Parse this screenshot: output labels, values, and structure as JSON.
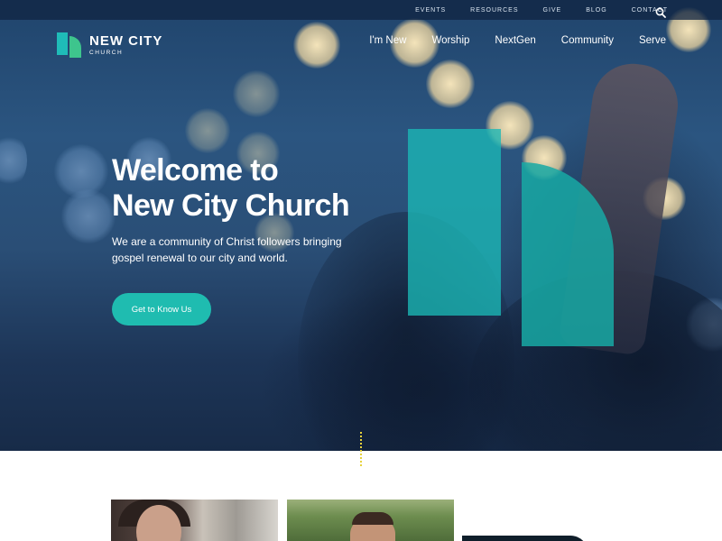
{
  "utility_nav": {
    "items": [
      "EVENTS",
      "RESOURCES",
      "GIVE",
      "BLOG",
      "CONTACT"
    ],
    "search_icon": "search-icon"
  },
  "logo": {
    "name": "NEW CITY",
    "sub": "CHURCH"
  },
  "main_nav": {
    "items": [
      "I'm New",
      "Worship",
      "NextGen",
      "Community",
      "Serve"
    ]
  },
  "hero": {
    "title_line1": "Welcome to",
    "title_line2": "New City Church",
    "subtitle": "We are a community of Christ followers bringing gospel renewal to our city and world.",
    "cta_label": "Get to Know Us"
  },
  "colors": {
    "accent_teal": "#1fbcb0",
    "logo_green": "#3ec58d",
    "hero_blue": "#2b5580",
    "scroll_line": "#e7d23c"
  }
}
